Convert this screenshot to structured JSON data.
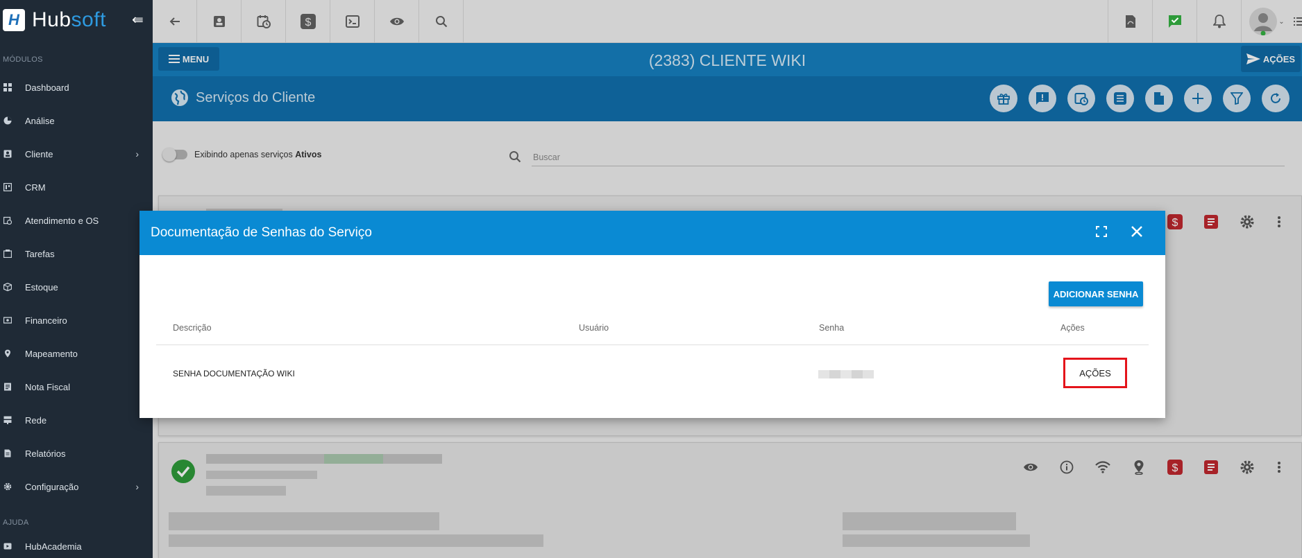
{
  "app": {
    "logo_hub": "Hub",
    "logo_soft": "soft"
  },
  "sidebar": {
    "section_modulos": "MÓDULOS",
    "section_ajuda": "AJUDA",
    "items": [
      {
        "label": "Dashboard"
      },
      {
        "label": "Análise"
      },
      {
        "label": "Cliente"
      },
      {
        "label": "CRM"
      },
      {
        "label": "Atendimento e OS"
      },
      {
        "label": "Tarefas"
      },
      {
        "label": "Estoque"
      },
      {
        "label": "Financeiro"
      },
      {
        "label": "Mapeamento"
      },
      {
        "label": "Nota Fiscal"
      },
      {
        "label": "Rede"
      },
      {
        "label": "Relatórios"
      },
      {
        "label": "Configuração"
      }
    ],
    "help_items": [
      {
        "label": "HubAcademia"
      }
    ]
  },
  "header": {
    "menu_label": "MENU",
    "title": "(2383) CLIENTE WIKI",
    "acoes_label": "AÇÕES"
  },
  "section": {
    "title": "Serviços do Cliente"
  },
  "filters": {
    "toggle_text": "Exibindo apenas serviços ",
    "toggle_bold": "Ativos",
    "search_placeholder": "Buscar"
  },
  "modal": {
    "title": "Documentação de Senhas do Serviço",
    "add_button": "ADICIONAR SENHA",
    "columns": [
      "Descrição",
      "Usuário",
      "Senha",
      "Ações"
    ],
    "rows": [
      {
        "descricao": "SENHA DOCUMENTAÇÃO WIKI",
        "usuario": "",
        "acoes": "AÇÕES"
      }
    ]
  },
  "colors": {
    "primary": "#1680c0",
    "modal_header": "#0a8ad3",
    "sidebar": "#1f2a36",
    "highlight": "#e4141b",
    "success": "#2e9b3a",
    "danger": "#c0282f"
  }
}
